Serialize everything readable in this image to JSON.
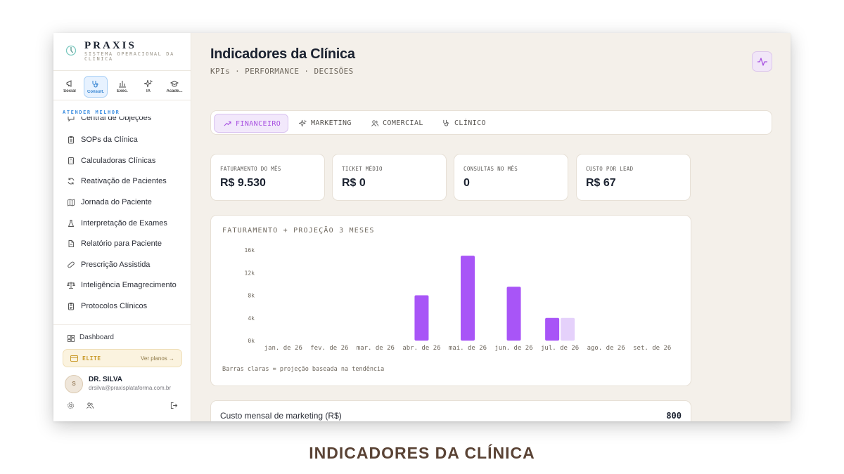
{
  "brand": {
    "name": "PRAXIS",
    "subtitle": "SISTEMA OPERACIONAL DA CLÍNICA"
  },
  "modes": [
    {
      "label": "Social",
      "icon": "megaphone-icon"
    },
    {
      "label": "Consult.",
      "icon": "stethoscope-icon",
      "active": true
    },
    {
      "label": "Exec.",
      "icon": "bar-chart-icon"
    },
    {
      "label": "IA",
      "icon": "sparkles-icon"
    },
    {
      "label": "Acade...",
      "icon": "graduation-cap-icon"
    }
  ],
  "sidebar": {
    "section_label": "ATENDER MELHOR",
    "items": [
      {
        "label": "Central de Objeções",
        "icon": "chat-icon"
      },
      {
        "label": "SOPs da Clínica",
        "icon": "clipboard-icon"
      },
      {
        "label": "Calculadoras Clínicas",
        "icon": "calculator-icon"
      },
      {
        "label": "Reativação de Pacientes",
        "icon": "refresh-icon"
      },
      {
        "label": "Jornada do Paciente",
        "icon": "map-icon"
      },
      {
        "label": "Interpretação de Exames",
        "icon": "flask-icon"
      },
      {
        "label": "Relatório para Paciente",
        "icon": "file-icon"
      },
      {
        "label": "Prescrição Assistida",
        "icon": "pill-icon"
      },
      {
        "label": "Inteligência Emagrecimento",
        "icon": "scale-icon"
      },
      {
        "label": "Protocolos Clínicos",
        "icon": "clipboard-list-icon"
      }
    ],
    "dashboard_label": "Dashboard",
    "plan": {
      "name": "ELITE",
      "link": "Ver planos →"
    },
    "user": {
      "initial": "S",
      "name": "DR. SILVA",
      "email": "drsilva@praxisplataforma.com.br"
    }
  },
  "page": {
    "title": "Indicadores da Clínica",
    "subtitle": "KPIs · PERFORMANCE · DECISÕES"
  },
  "tabs": [
    {
      "label": "FINANCEIRO",
      "icon": "trend-up-icon",
      "active": true
    },
    {
      "label": "MARKETING",
      "icon": "sparkles-icon"
    },
    {
      "label": "COMERCIAL",
      "icon": "users-icon"
    },
    {
      "label": "CLÍNICO",
      "icon": "stethoscope-icon"
    }
  ],
  "kpis": [
    {
      "label": "FATURAMENTO DO MÊS",
      "value": "R$ 9.530"
    },
    {
      "label": "TICKET MÉDIO",
      "value": "R$ 0"
    },
    {
      "label": "CONSULTAS NO MÊS",
      "value": "0"
    },
    {
      "label": "CUSTO POR LEAD",
      "value": "R$ 67"
    }
  ],
  "chart_data": {
    "type": "bar",
    "title": "FATURAMENTO + PROJEÇÃO 3 MESES",
    "categories": [
      "jan. de 26",
      "fev. de 26",
      "mar. de 26",
      "abr. de 26",
      "mai. de 26",
      "jun. de 26",
      "jul. de 26",
      "ago. de 26",
      "set. de 26"
    ],
    "series": [
      {
        "values": [
          0,
          0,
          0,
          8000,
          15000,
          9500,
          4000,
          0,
          0
        ],
        "color": "#a855f7"
      },
      {
        "values": [
          0,
          0,
          0,
          0,
          0,
          0,
          4000,
          0,
          0
        ],
        "color": "#e5d1fb",
        "projection": true
      }
    ],
    "yticks": [
      "0k",
      "4k",
      "8k",
      "12k",
      "16k"
    ],
    "ylim": [
      0,
      16000
    ],
    "note": "Barras claras = projeção baseada na tendência"
  },
  "marketing_cost": {
    "label": "Custo mensal de marketing (R$)",
    "value": "800"
  },
  "caption": "INDICADORES DA CLÍNICA",
  "colors": {
    "accent": "#a855f7",
    "projection": "#e5d1fb",
    "info": "#3d8ee0",
    "gold": "#c99a2a"
  }
}
